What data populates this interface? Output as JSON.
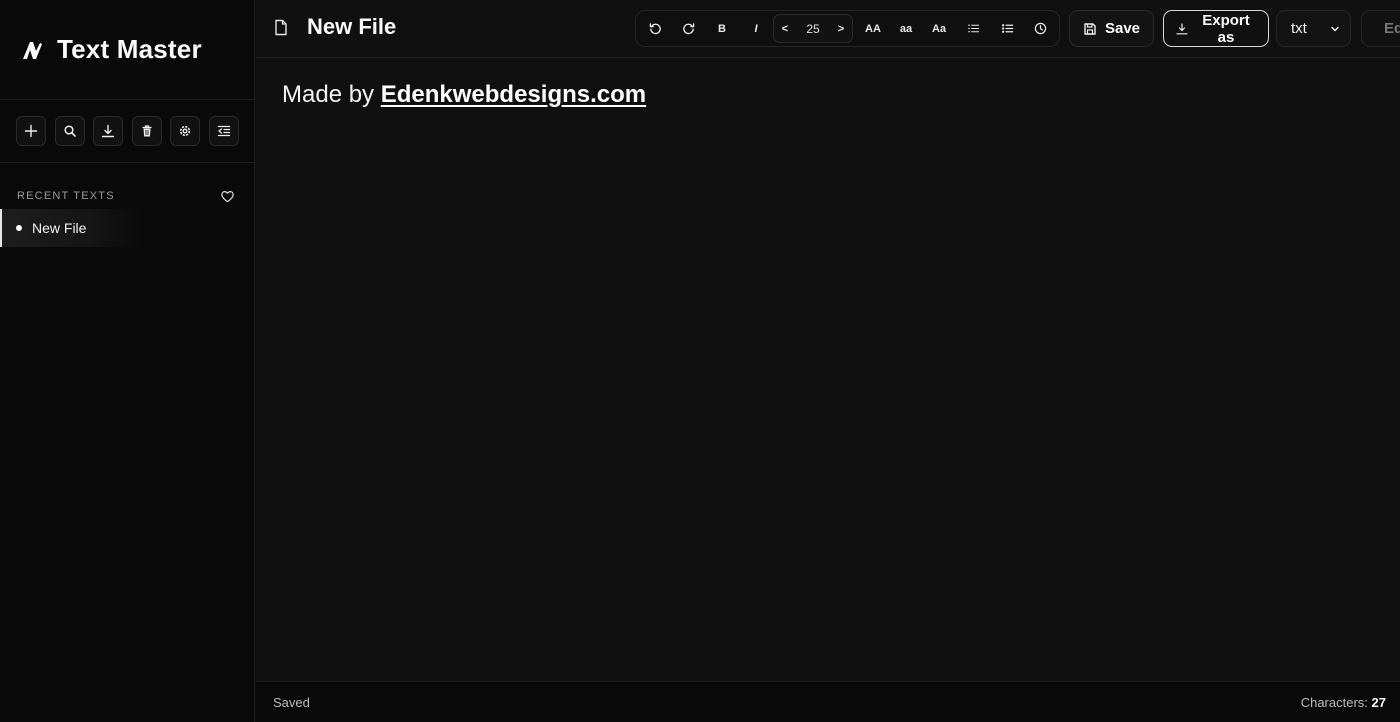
{
  "app": {
    "title": "Text Master"
  },
  "sidebar": {
    "tools": [
      {
        "name": "new-file-button",
        "icon": "plus-icon"
      },
      {
        "name": "search-button",
        "icon": "search-icon"
      },
      {
        "name": "download-button",
        "icon": "download-icon"
      },
      {
        "name": "delete-button",
        "icon": "trash-icon"
      },
      {
        "name": "settings-button",
        "icon": "gear-icon"
      },
      {
        "name": "collapse-sidebar-button",
        "icon": "indent-icon"
      }
    ],
    "recent_label": "RECENT TEXTS",
    "recent_items": [
      {
        "label": "New File",
        "active": true
      }
    ]
  },
  "header": {
    "doc_title": "New File",
    "format_bar": {
      "undo_icon": "undo-icon",
      "redo_icon": "redo-icon",
      "bold_label": "B",
      "italic_label": "I",
      "decrease_label": "<",
      "font_size": "25",
      "increase_label": ">",
      "uppercase_label": "AA",
      "lowercase_label": "aa",
      "titlecase_label": "Aa",
      "bullet_list_icon": "list-icon",
      "numbered_list_icon": "list-ordered-icon",
      "history_icon": "clock-icon"
    },
    "save_label": "Save",
    "export_label": "Export as",
    "export_type": "txt",
    "cut_off_label": "Ed"
  },
  "editor": {
    "text_prefix": "Made by ",
    "link_text": "Edenkwebdesigns.com"
  },
  "status": {
    "state": "Saved",
    "chars_label": "Characters:",
    "chars_count": "27"
  },
  "colors": {
    "background": "#101010",
    "sidebar": "#090909",
    "text": "#f2f2f2",
    "muted": "#9a9a9a",
    "border": "#252525"
  }
}
